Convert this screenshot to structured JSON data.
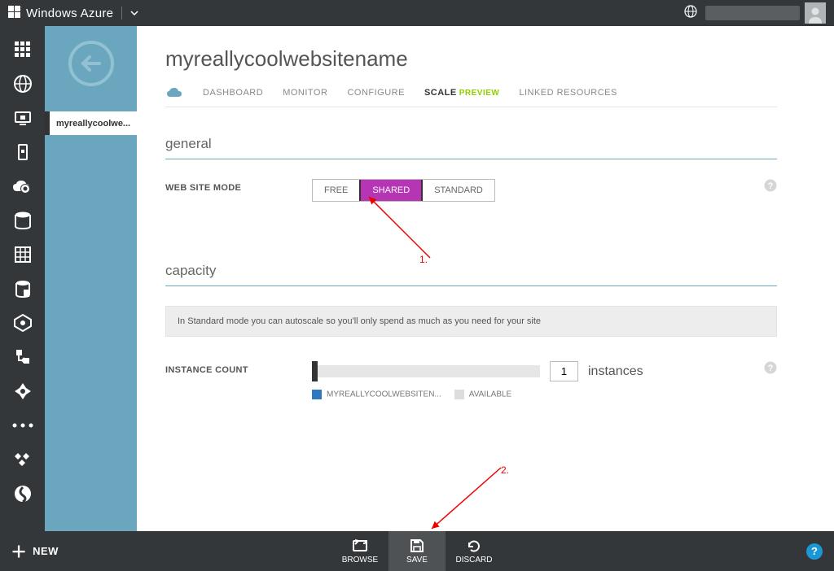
{
  "topbar": {
    "brand": "Windows Azure"
  },
  "sidebar": {
    "site_tab": "myreallycoolwe..."
  },
  "page": {
    "title": "myreallycoolwebsitename",
    "tabs": {
      "dashboard": "DASHBOARD",
      "monitor": "MONITOR",
      "configure": "CONFIGURE",
      "scale": "SCALE",
      "scale_preview": "PREVIEW",
      "linked": "LINKED RESOURCES"
    }
  },
  "general": {
    "heading": "general",
    "mode_label": "WEB SITE MODE",
    "modes": {
      "free": "FREE",
      "shared": "SHARED",
      "standard": "STANDARD"
    },
    "selected_mode": "SHARED"
  },
  "capacity": {
    "heading": "capacity",
    "info": "In Standard mode you can autoscale so you'll only spend as much as you need for your site",
    "count_label": "INSTANCE COUNT",
    "count_value": "1",
    "unit": "instances",
    "legend_site": "MYREALLYCOOLWEBSITEN...",
    "legend_available": "AVAILABLE"
  },
  "annotations": {
    "one": "1.",
    "two": "2."
  },
  "footer": {
    "new": "NEW",
    "browse": "BROWSE",
    "save": "SAVE",
    "discard": "DISCARD"
  }
}
